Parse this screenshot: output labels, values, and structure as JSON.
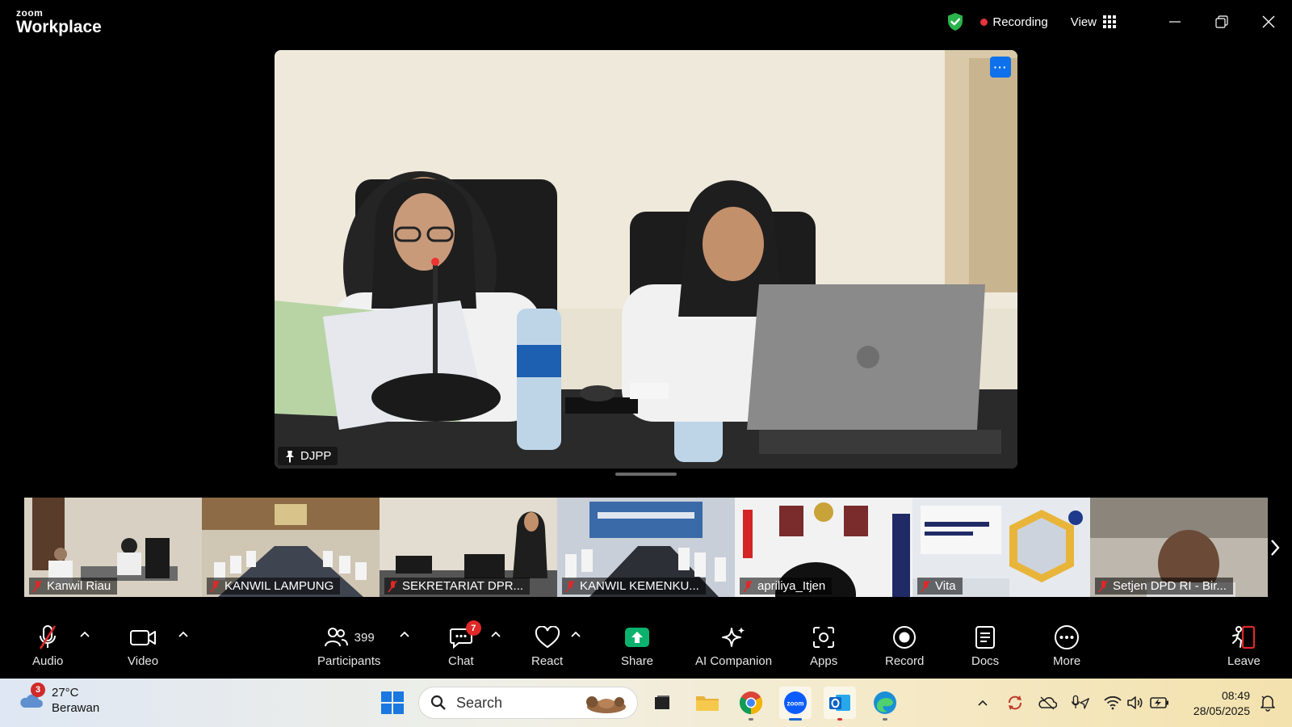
{
  "app": {
    "logo_small": "zoom",
    "logo_big": "Workplace"
  },
  "titlebar": {
    "recording_label": "Recording",
    "view_label": "View",
    "colors": {
      "recording_dot": "#e5343c",
      "shield": "#2bb24c"
    }
  },
  "main_video": {
    "name": "DJPP",
    "pinned": true
  },
  "gallery": [
    {
      "name": "Kanwil Riau",
      "muted": true
    },
    {
      "name": "KANWIL LAMPUNG",
      "muted": true
    },
    {
      "name": "SEKRETARIAT DPR...",
      "muted": true
    },
    {
      "name": "KANWIL KEMENKU...",
      "muted": true
    },
    {
      "name": "apriliya_Itjen",
      "muted": true
    },
    {
      "name": "Vita",
      "muted": true
    },
    {
      "name": "Setjen DPD RI - Bir...",
      "muted": true
    }
  ],
  "toolbar": {
    "audio": "Audio",
    "video": "Video",
    "participants": "Participants",
    "participants_count": "399",
    "chat": "Chat",
    "chat_badge": "7",
    "react": "React",
    "share": "Share",
    "ai_companion": "AI Companion",
    "apps": "Apps",
    "record": "Record",
    "docs": "Docs",
    "more": "More",
    "leave": "Leave",
    "colors": {
      "share": "#0bb26e",
      "leave": "#e02828",
      "badge": "#e02828"
    }
  },
  "taskbar": {
    "weather_temp": "27°C",
    "weather_desc": "Berawan",
    "weather_badge": "3",
    "search_placeholder": "Search",
    "time": "08:49",
    "date": "28/05/2025"
  }
}
